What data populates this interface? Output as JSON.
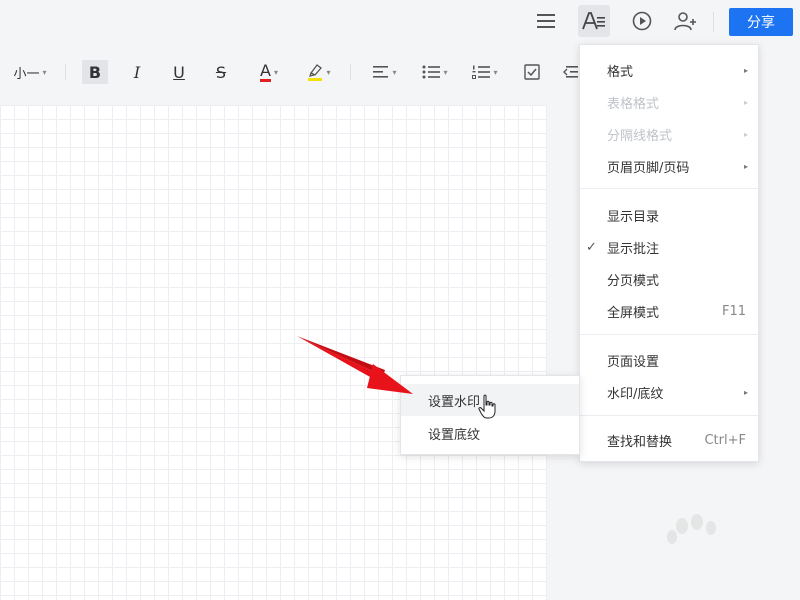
{
  "header": {
    "share_label": "分享",
    "icons": [
      "menu-icon",
      "text-format-icon",
      "play-icon",
      "add-user-icon"
    ]
  },
  "toolbar": {
    "font_size": "小一",
    "bold": "B",
    "italic": "I",
    "underline": "U",
    "strike": "S",
    "font_color": "A",
    "font_color_hex": "#e02020",
    "highlight_hex": "#f5e10a"
  },
  "menu": {
    "items": [
      {
        "label": "格式",
        "submenu": true,
        "disabled": false
      },
      {
        "label": "表格格式",
        "submenu": true,
        "disabled": true
      },
      {
        "label": "分隔线格式",
        "submenu": true,
        "disabled": true
      },
      {
        "label": "页眉页脚/页码",
        "submenu": true,
        "disabled": false
      },
      {
        "label": "显示目录",
        "submenu": false,
        "disabled": false
      },
      {
        "label": "显示批注",
        "submenu": false,
        "disabled": false,
        "checked": true
      },
      {
        "label": "分页模式",
        "submenu": false,
        "disabled": false
      },
      {
        "label": "全屏模式",
        "shortcut": "F11"
      },
      {
        "label": "页面设置"
      },
      {
        "label": "水印/底纹",
        "submenu": true
      },
      {
        "label": "查找和替换",
        "shortcut": "Ctrl+F"
      }
    ],
    "check_mark": "✓",
    "submenu_arrow": "▸"
  },
  "submenu": {
    "items": [
      {
        "label": "设置水印",
        "hover": true
      },
      {
        "label": "设置底纹",
        "hover": false
      }
    ]
  },
  "colors": {
    "accent": "#1c74f2",
    "annotation_arrow": "#e8131a"
  }
}
